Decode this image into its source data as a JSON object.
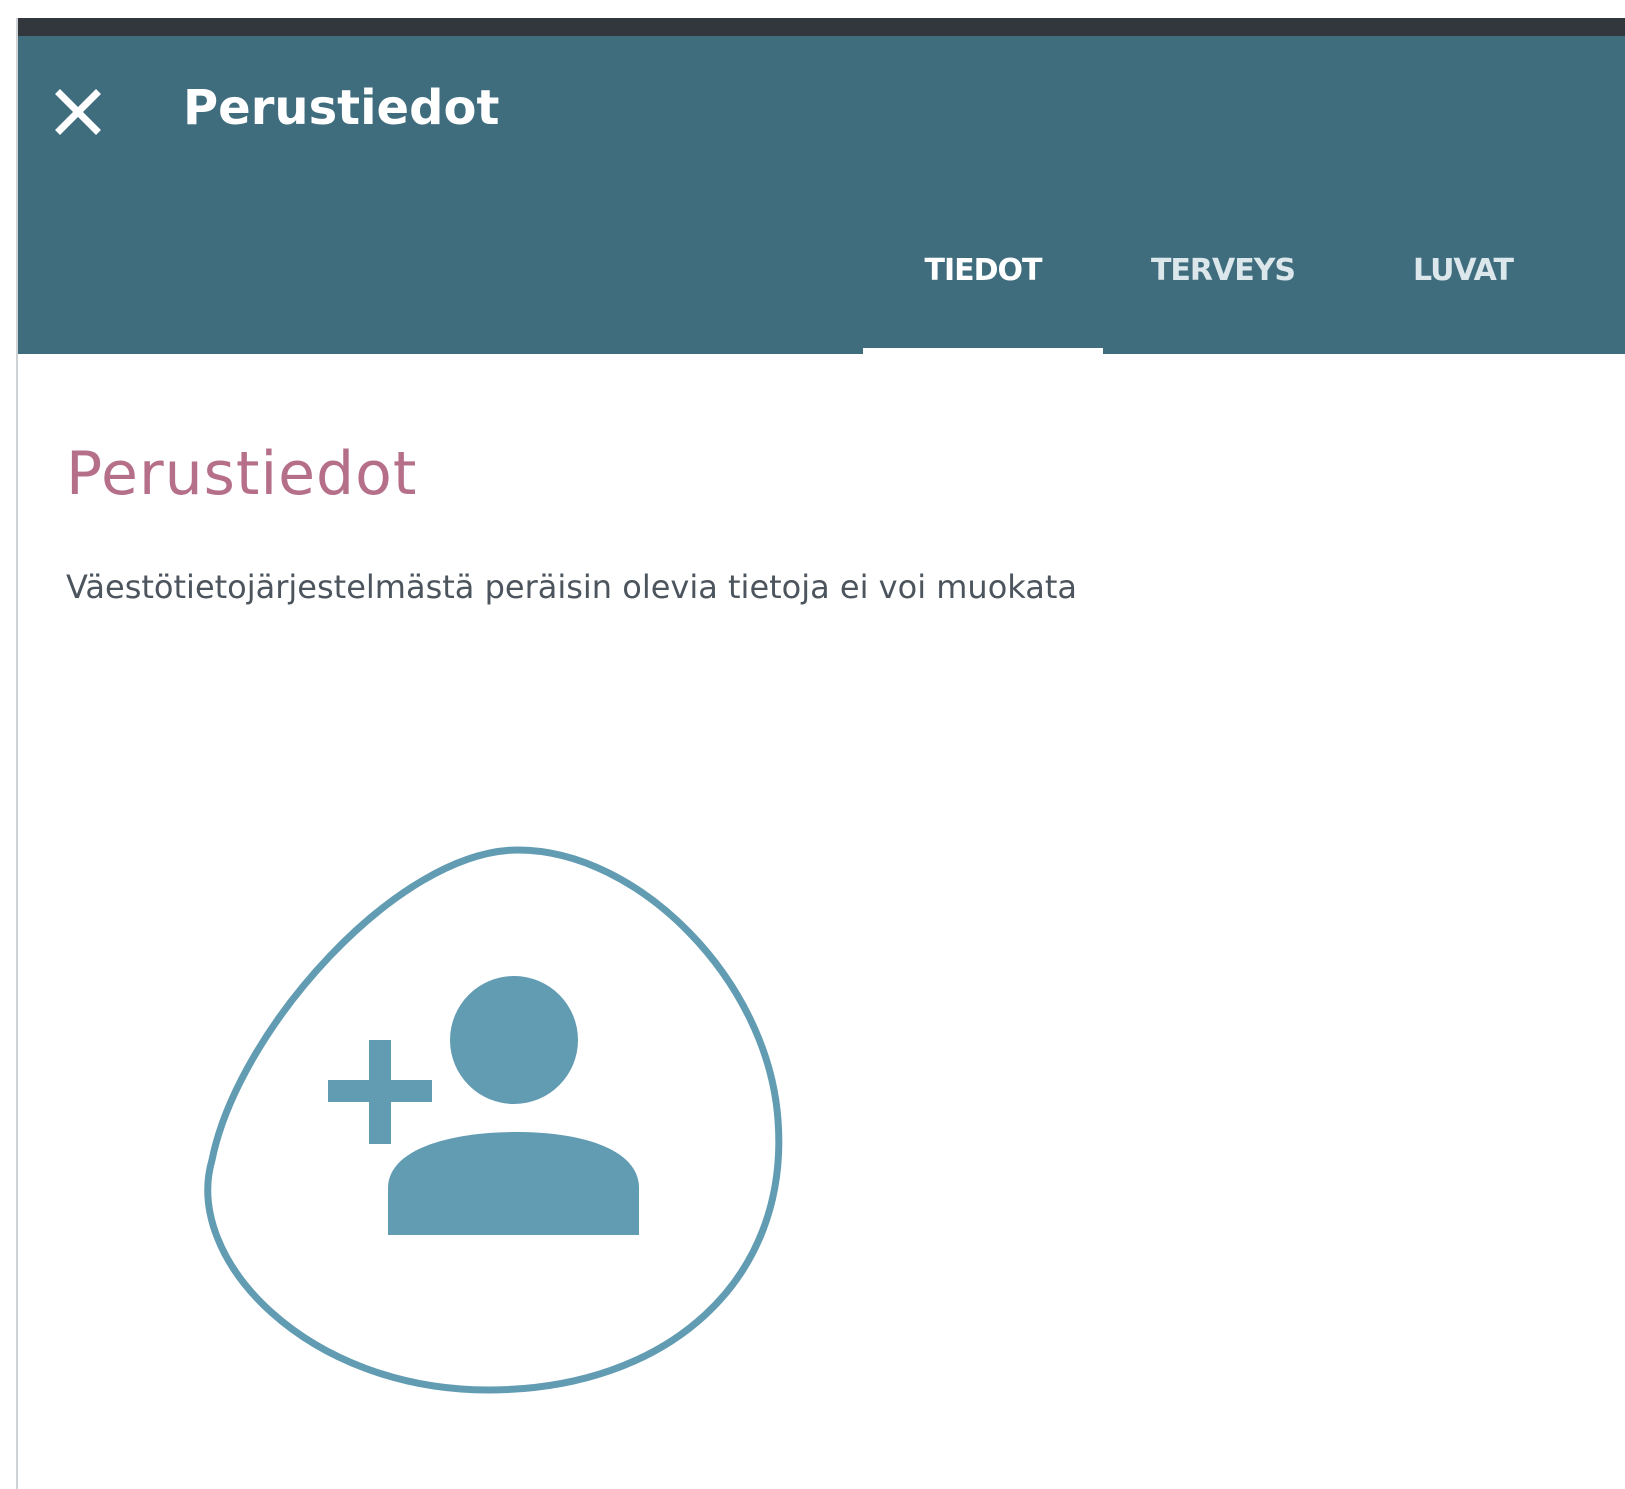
{
  "header": {
    "title": "Perustiedot",
    "close_icon": "close-icon",
    "background_color": "#3f6d7e"
  },
  "tabs": [
    {
      "label": "TIEDOT",
      "active": true
    },
    {
      "label": "TERVEYS",
      "active": false
    },
    {
      "label": "LUVAT",
      "active": false
    }
  ],
  "main": {
    "section_title": "Perustiedot",
    "info_text": "Väestötietojärjestelmästä peräisin olevia tietoja ei voi muokata",
    "add_person_icon": "add-person-icon"
  },
  "colors": {
    "accent": "#b56f89",
    "icon": "#629cb2",
    "text": "#4c555d"
  }
}
